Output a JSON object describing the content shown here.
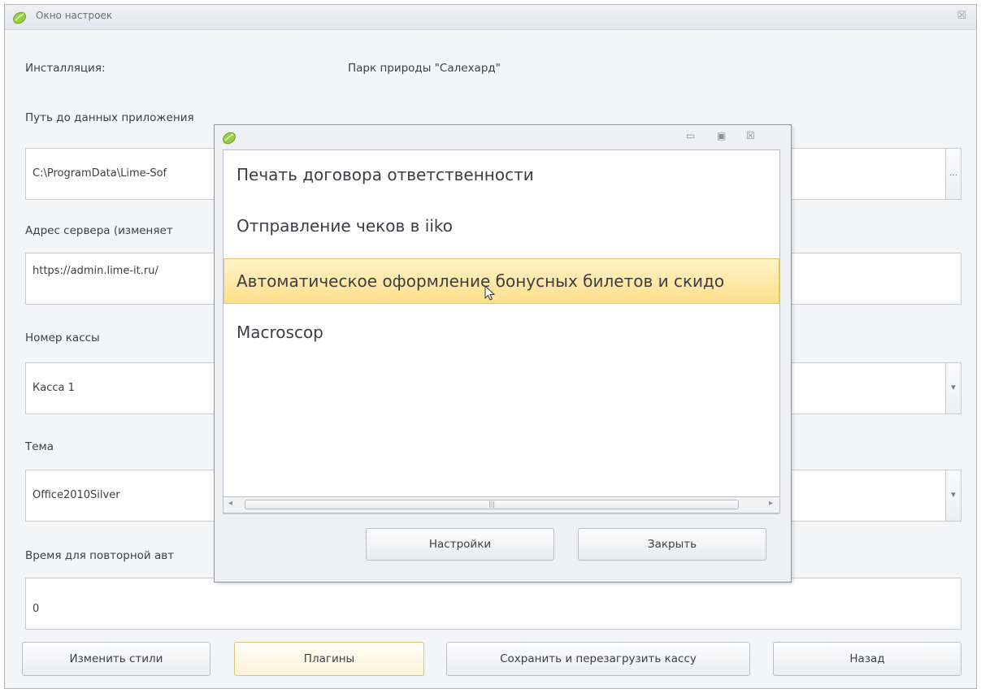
{
  "window": {
    "title": "Окно настроек",
    "close_glyph": "☒"
  },
  "form": {
    "installation_label": "Инсталляция:",
    "installation_value": "Парк природы \"Салехард\"",
    "data_path_label": "Путь до данных приложения",
    "data_path_value": "C:\\ProgramData\\Lime-Sof",
    "data_path_browse": "...",
    "server_label": "Адрес сервера (изменяет",
    "server_value": "https://admin.lime-it.ru/",
    "register_label": "Номер кассы",
    "register_value": "Касса 1",
    "theme_label": "Тема",
    "theme_value": "Office2010Silver",
    "reauth_label": "Время для повторной авт",
    "reauth_value": "0"
  },
  "buttons": {
    "change_styles": "Изменить стили",
    "plugins": "Плагины",
    "save_restart": "Сохранить и перезагрузить кассу",
    "back": "Назад"
  },
  "dialog": {
    "minimize_glyph": "▭",
    "maximize_glyph": "▣",
    "close_glyph": "☒",
    "items": [
      "Печать договора ответственности",
      "Отправление чеков в iiko",
      "Автоматическое оформление бонусных билетов и скидо",
      "Macroscop"
    ],
    "selected_index": 2,
    "settings_button": "Настройки",
    "close_button": "Закрыть"
  },
  "colors": {
    "highlight": "#fddf89",
    "focus_border": "#e0c470",
    "icon_green": "#8cc63f"
  }
}
